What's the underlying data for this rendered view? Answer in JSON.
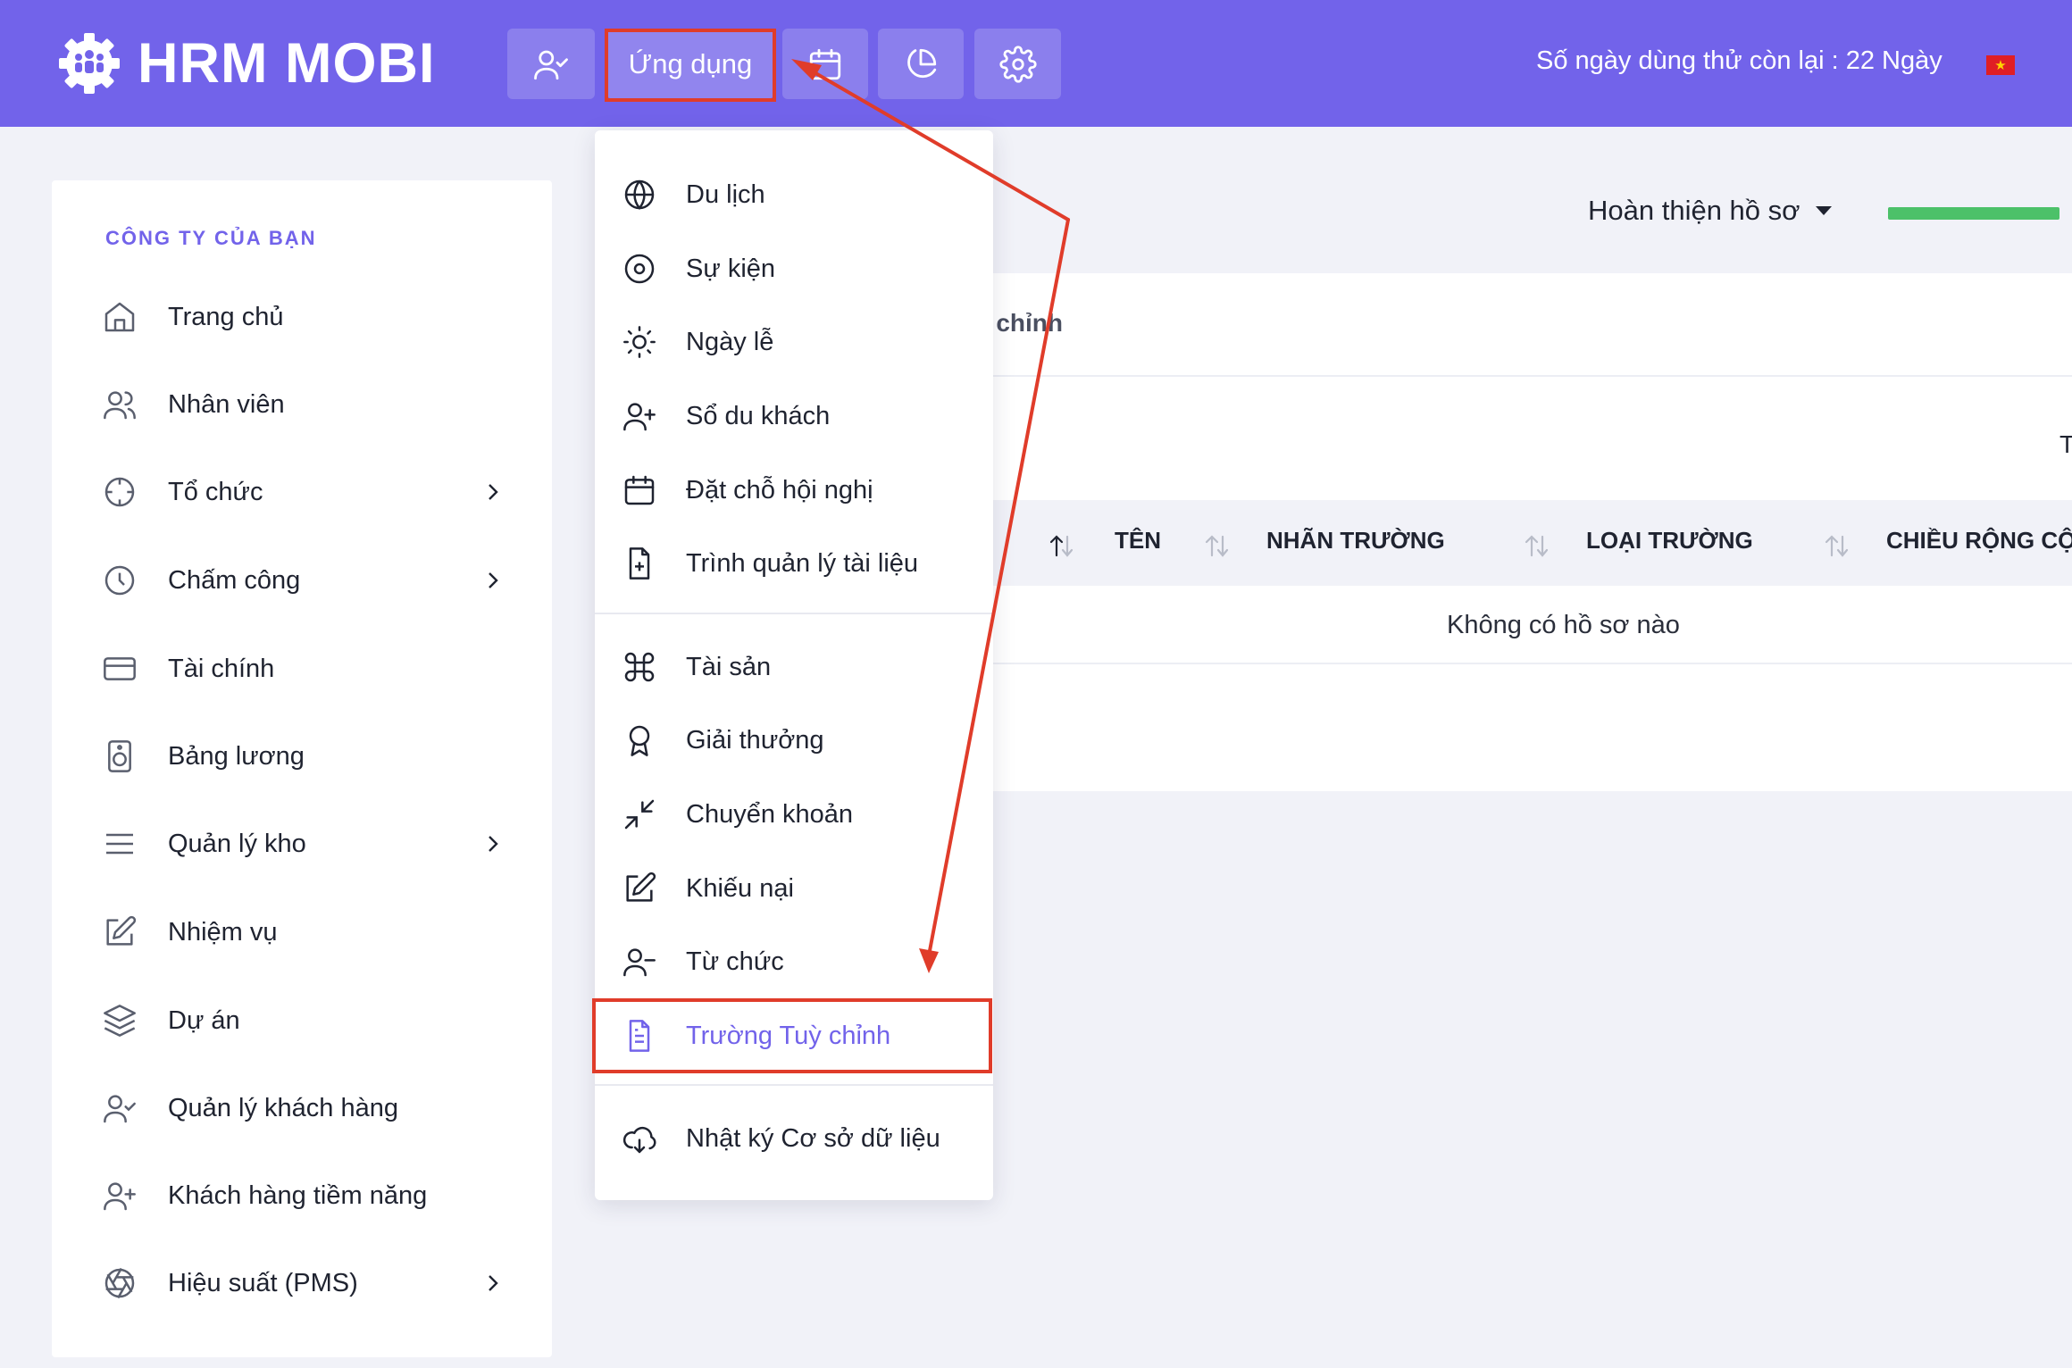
{
  "header": {
    "brand": "HRM MOBI",
    "nav_buttons": [
      {
        "icon": "user-check-icon"
      },
      {
        "label": "Ứng dụng"
      },
      {
        "icon": "calendar-icon"
      },
      {
        "icon": "pie-chart-icon"
      },
      {
        "icon": "gear-icon"
      }
    ],
    "trial_text": "Số ngày dùng thử còn lại : 22 Ngày",
    "flag": "vietnam-flag-icon"
  },
  "sidebar": {
    "section_title": "CÔNG TY CỦA BẠN",
    "items": [
      {
        "label": "Trang chủ",
        "icon": "home-icon"
      },
      {
        "label": "Nhân viên",
        "icon": "users-icon"
      },
      {
        "label": "Tổ chức",
        "icon": "crosshair-icon",
        "has_submenu": true
      },
      {
        "label": "Chấm công",
        "icon": "clock-icon",
        "has_submenu": true
      },
      {
        "label": "Tài chính",
        "icon": "credit-card-icon"
      },
      {
        "label": "Bảng lương",
        "icon": "speaker-icon"
      },
      {
        "label": "Quản lý kho",
        "icon": "menu-lines-icon",
        "has_submenu": true
      },
      {
        "label": "Nhiệm vụ",
        "icon": "edit-icon"
      },
      {
        "label": "Dự án",
        "icon": "layers-icon"
      },
      {
        "label": "Quản lý khách hàng",
        "icon": "user-check-icon"
      },
      {
        "label": "Khách hàng tiềm năng",
        "icon": "user-plus-icon"
      },
      {
        "label": "Hiệu suất (PMS)",
        "icon": "aperture-icon",
        "has_submenu": true
      }
    ]
  },
  "main": {
    "profile_completion": "Hoàn thiện hồ sơ",
    "card_title_partial": "y chỉnh",
    "cut_letter": "T",
    "table": {
      "headers": [
        "TÊN",
        "NHÃN TRƯỜNG",
        "LOẠI TRƯỜNG",
        "CHIỀU RỘNG CỘ"
      ],
      "empty_text": "Không có hồ sơ nào"
    }
  },
  "app_menu": {
    "group1": [
      {
        "label": "Du lịch",
        "icon": "globe-icon"
      },
      {
        "label": "Sự kiện",
        "icon": "disc-icon"
      },
      {
        "label": "Ngày lễ",
        "icon": "sun-icon"
      },
      {
        "label": "Sổ du khách",
        "icon": "user-plus-icon"
      },
      {
        "label": "Đặt chỗ hội nghị",
        "icon": "calendar-icon"
      },
      {
        "label": "Trình quản lý tài liệu",
        "icon": "file-plus-icon"
      }
    ],
    "group2": [
      {
        "label": "Tài sản",
        "icon": "command-icon"
      },
      {
        "label": "Giải thưởng",
        "icon": "award-icon"
      },
      {
        "label": "Chuyển khoản",
        "icon": "minimize-icon"
      },
      {
        "label": "Khiếu nại",
        "icon": "edit-icon"
      },
      {
        "label": "Từ chức",
        "icon": "user-minus-icon"
      },
      {
        "label": "Trường Tuỳ chỉnh",
        "icon": "file-text-icon",
        "active": true
      }
    ],
    "group3": [
      {
        "label": "Nhật ký Cơ sở dữ liệu",
        "icon": "cloud-download-icon"
      }
    ]
  },
  "colors": {
    "primary": "#7263ea",
    "annotation": "#e03c2a",
    "progress": "#4cc169"
  }
}
